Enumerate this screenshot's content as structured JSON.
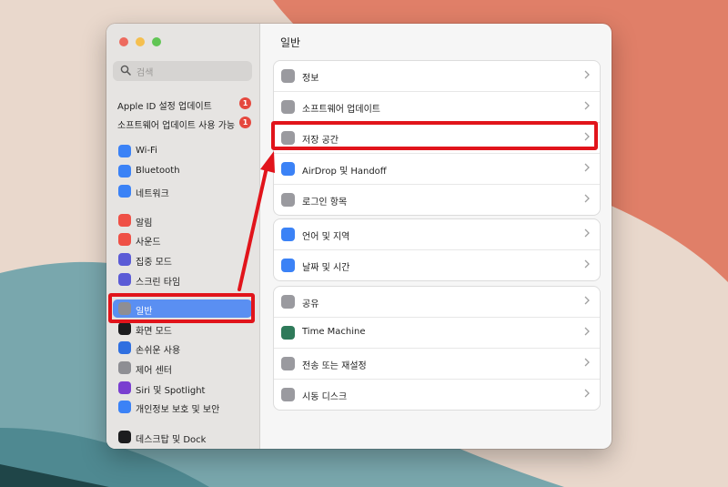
{
  "window": {
    "traffic_lights": [
      "#ed6a5e",
      "#f5bf4f",
      "#61c554"
    ]
  },
  "sidebar": {
    "search_placeholder": "검색",
    "apple_id": [
      {
        "label": "Apple ID 설정 업데이트",
        "badge": "1"
      },
      {
        "label": "소프트웨어 업데이트 사용 가능",
        "badge": "1"
      }
    ],
    "items": [
      {
        "label": "Wi-Fi",
        "icon": "wifi-icon",
        "color": "#3b82f6"
      },
      {
        "label": "Bluetooth",
        "icon": "bluetooth-icon",
        "color": "#3b82f6"
      },
      {
        "label": "네트워크",
        "icon": "globe-icon",
        "color": "#3b82f6"
      },
      {
        "label": "알림",
        "icon": "bell-icon",
        "color": "#ef5046"
      },
      {
        "label": "사운드",
        "icon": "speaker-icon",
        "color": "#ef5046"
      },
      {
        "label": "집중 모드",
        "icon": "moon-icon",
        "color": "#5b5bd6"
      },
      {
        "label": "스크린 타임",
        "icon": "hourglass-icon",
        "color": "#5b5bd6"
      },
      {
        "label": "일반",
        "icon": "gear-icon",
        "color": "#8e8e93"
      },
      {
        "label": "화면 모드",
        "icon": "appearance-icon",
        "color": "#1c1c1e"
      },
      {
        "label": "손쉬운 사용",
        "icon": "accessibility-icon",
        "color": "#2f6fe0"
      },
      {
        "label": "제어 센터",
        "icon": "control-center-icon",
        "color": "#8e8e93"
      },
      {
        "label": "Siri 및 Spotlight",
        "icon": "siri-icon",
        "color": "#7a3fd0"
      },
      {
        "label": "개인정보 보호 및 보안",
        "icon": "hand-icon",
        "color": "#3b82f6"
      },
      {
        "label": "데스크탑 및 Dock",
        "icon": "dock-icon",
        "color": "#1c1c1e"
      }
    ]
  },
  "main": {
    "title": "일반",
    "groups": [
      [
        {
          "label": "정보",
          "icon": "info-icon",
          "color": "#9a9a9f"
        },
        {
          "label": "소프트웨어 업데이트",
          "icon": "gear-icon",
          "color": "#9a9a9f"
        },
        {
          "label": "저장 공간",
          "icon": "storage-icon",
          "color": "#9a9a9f"
        },
        {
          "label": "AirDrop 및 Handoff",
          "icon": "airdrop-icon",
          "color": "#3b82f6"
        },
        {
          "label": "로그인 항목",
          "icon": "list-icon",
          "color": "#9a9a9f"
        }
      ],
      [
        {
          "label": "언어 및 지역",
          "icon": "globe-icon",
          "color": "#3b82f6"
        },
        {
          "label": "날짜 및 시간",
          "icon": "calendar-icon",
          "color": "#3b82f6"
        }
      ],
      [
        {
          "label": "공유",
          "icon": "share-icon",
          "color": "#9a9a9f"
        },
        {
          "label": "Time Machine",
          "icon": "clock-icon",
          "color": "#2f7a5a"
        },
        {
          "label": "전송 또는 재설정",
          "icon": "reset-icon",
          "color": "#9a9a9f"
        },
        {
          "label": "시동 디스크",
          "icon": "disk-icon",
          "color": "#9a9a9f"
        }
      ]
    ]
  },
  "annotation": {
    "highlight_color": "#e1141b"
  }
}
